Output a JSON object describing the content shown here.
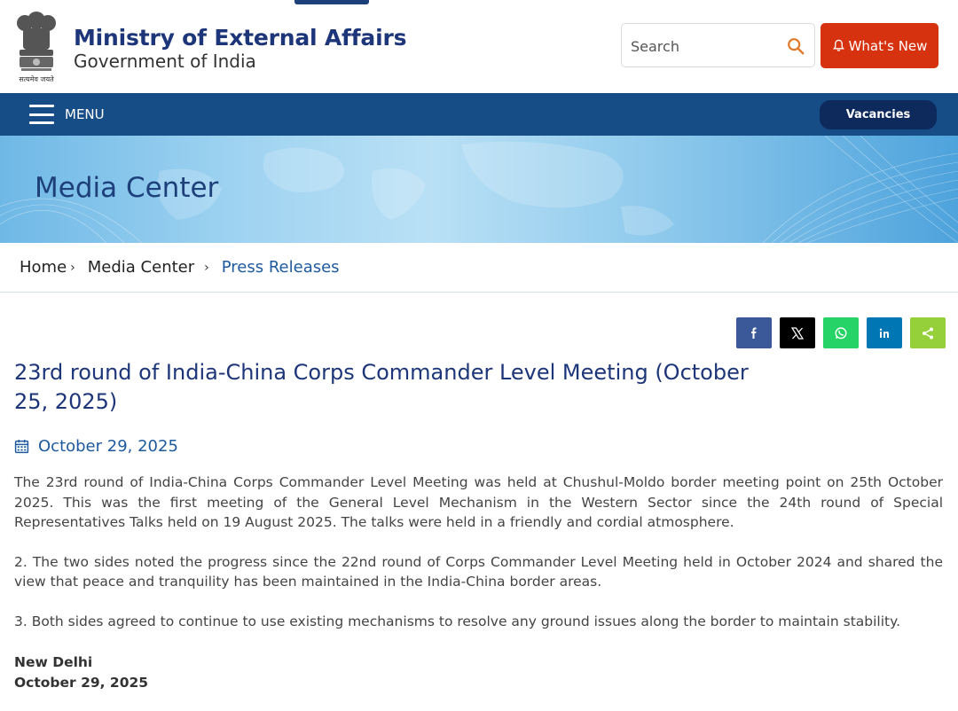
{
  "header": {
    "ministry_name": "Ministry of External Affairs",
    "government_name": "Government of India",
    "emblem_motto": "सत्यमेव जयते",
    "search_placeholder": "Search",
    "whats_new_label": "What's New"
  },
  "navbar": {
    "menu_label": "MENU",
    "vacancies_label": "Vacancies"
  },
  "banner": {
    "title": "Media Center"
  },
  "breadcrumb": {
    "items": [
      "Home",
      "Media Center",
      "Press Releases"
    ],
    "separator": "›"
  },
  "share": {
    "buttons": [
      {
        "icon": "facebook-icon",
        "color": "#3b5998"
      },
      {
        "icon": "x-twitter-icon",
        "color": "#000000"
      },
      {
        "icon": "whatsapp-icon",
        "color": "#25d366"
      },
      {
        "icon": "linkedin-icon",
        "color": "#0077b5"
      },
      {
        "icon": "share-icon",
        "color": "#95d03a"
      }
    ]
  },
  "article": {
    "title": "23rd round of India-China Corps Commander Level Meeting (October 25, 2025)",
    "date": "October 29, 2025",
    "paragraphs": [
      "The 23rd round of India-China Corps Commander Level Meeting was held at Chushul-Moldo border meeting point on 25th October 2025. This was the first meeting of the General Level Mechanism in the Western Sector since the 24th round of Special Representatives Talks held on 19 August 2025. The talks were held in a friendly and cordial atmosphere.",
      "2. The two sides noted the progress since the 22nd round of Corps Commander Level Meeting held in October 2024 and shared the view that peace and tranquility has been maintained in the India-China border areas.",
      "3. Both sides agreed to continue to use existing mechanisms to resolve any ground issues along the border to maintain stability."
    ],
    "place": "New Delhi",
    "sign_date": "October 29, 2025"
  },
  "colors": {
    "brand_blue": "#1d3579",
    "nav_blue": "#174d87",
    "whats_new_red": "#d7320f",
    "vacancies_navy": "#0e2a5c"
  }
}
